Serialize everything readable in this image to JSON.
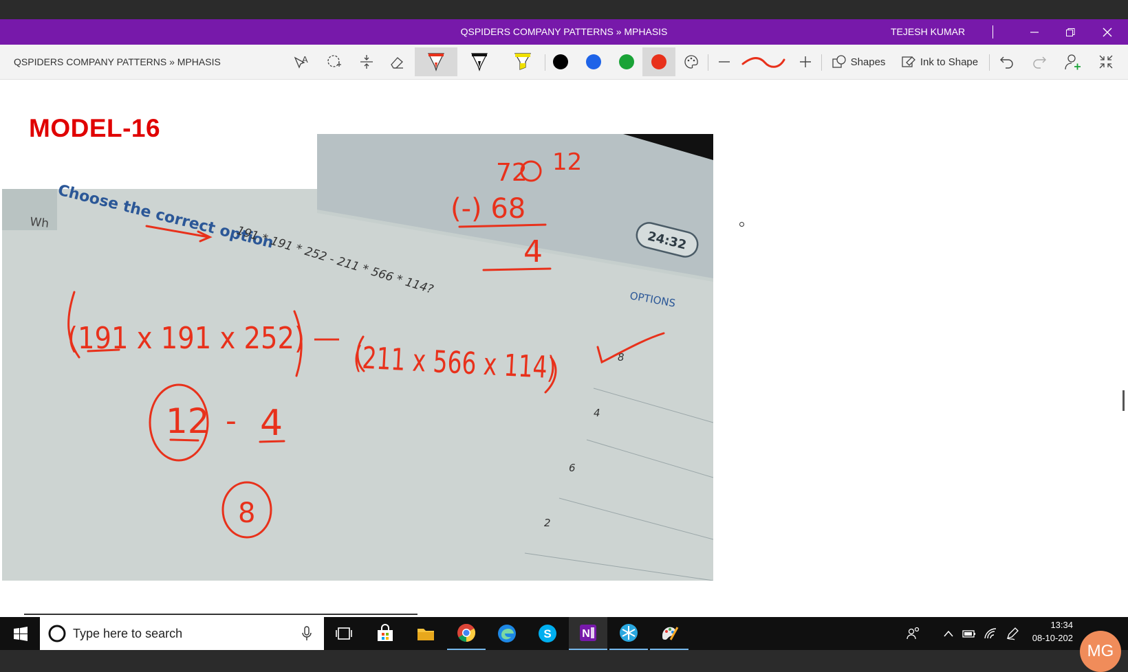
{
  "window": {
    "title": "QSPIDERS COMPANY PATTERNS » MPHASIS",
    "user": "TEJESH KUMAR"
  },
  "toolbar": {
    "breadcrumb": "QSPIDERS COMPANY PATTERNS » MPHASIS",
    "shapes_label": "Shapes",
    "ink_to_shape_label": "Ink to Shape",
    "pen_colors": [
      "#000000",
      "#1e63e8",
      "#1aa337",
      "#e8311b"
    ],
    "selected_color": "#e8311b"
  },
  "page": {
    "heading": "MODEL-16"
  },
  "photo": {
    "question_header": "Choose the correct option",
    "question_prefix": "Wh",
    "question_expr": "191 * 191 * 252 - 211 * 566 * 114?",
    "timer": "24:32",
    "options_label": "OPTIONS",
    "options": [
      "8",
      "4",
      "6",
      "2"
    ]
  },
  "ink": {
    "sub_top": "72",
    "sub_top_corr": "12",
    "sub_second": "(-) 68",
    "sub_result": "4",
    "expr_left": "(191 x 191 x 252)",
    "minus": "—",
    "expr_right": "(211 x 566 x 114)",
    "step_a": "12",
    "step_dash": "-",
    "step_b": "4",
    "answer": "8"
  },
  "taskbar": {
    "search_placeholder": "Type here to search",
    "time": "13:34",
    "date": "08-10-202"
  },
  "avatar_initials": "MG"
}
